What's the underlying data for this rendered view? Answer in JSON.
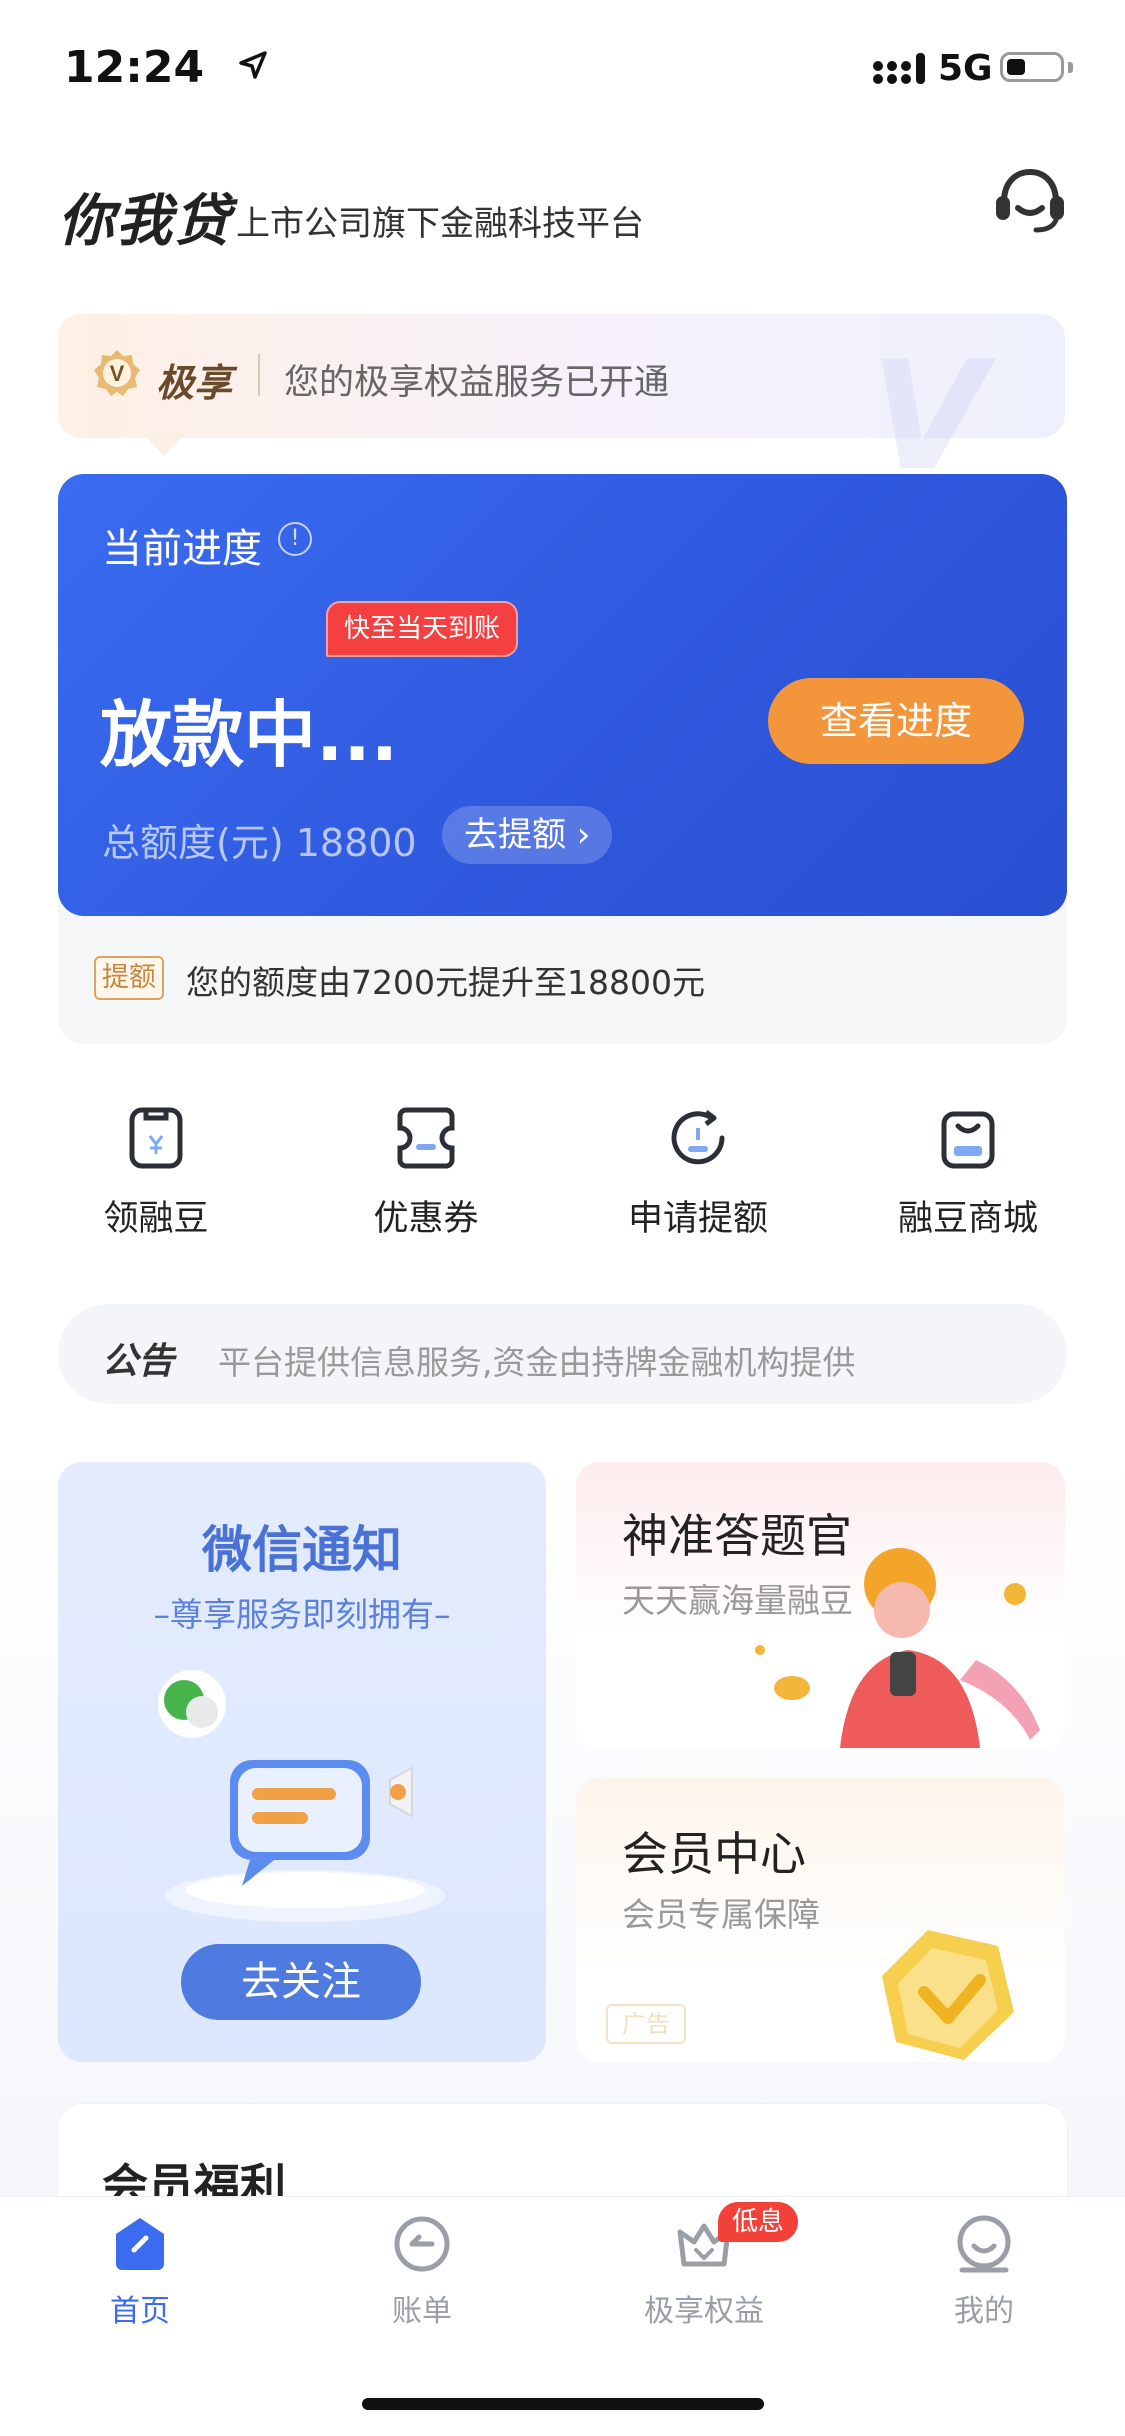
{
  "status_bar": {
    "time": "12:24",
    "network": "5G"
  },
  "header": {
    "brand": "你我贷",
    "subtitle": "上市公司旗下金融科技平台"
  },
  "vip_banner": {
    "title": "极享",
    "text": "您的极享权益服务已开通"
  },
  "progress": {
    "label": "当前进度",
    "fast_tag": "快至当天到账",
    "status": "放款中...",
    "check_button": "查看进度",
    "limit_text": "总额度(元) 18800",
    "raise_button": "去提额",
    "tip_tag": "提额",
    "tip_text": "您的额度由7200元提升至18800元"
  },
  "quick_actions": [
    {
      "label": "领融豆",
      "icon": "bean-icon"
    },
    {
      "label": "优惠券",
      "icon": "coupon-icon"
    },
    {
      "label": "申请提额",
      "icon": "raise-limit-icon"
    },
    {
      "label": "融豆商城",
      "icon": "shop-bag-icon"
    }
  ],
  "notice": {
    "title": "公告",
    "text": "平台提供信息服务,资金由持牌金融机构提供"
  },
  "wechat_card": {
    "title": "微信通知",
    "subtitle": "–尊享服务即刻拥有–",
    "button": "去关注"
  },
  "quiz_card": {
    "title": "神准答题官",
    "subtitle": "天天赢海量融豆"
  },
  "member_card": {
    "title": "会员中心",
    "subtitle": "会员专属保障",
    "ad_tag": "广告"
  },
  "welfare": {
    "title": "会员福利"
  },
  "tabbar": {
    "items": [
      {
        "label": "首页",
        "icon": "home-icon",
        "active": true
      },
      {
        "label": "账单",
        "icon": "bill-icon",
        "active": false
      },
      {
        "label": "极享权益",
        "icon": "crown-icon",
        "active": false
      },
      {
        "label": "我的",
        "icon": "profile-icon",
        "active": false
      }
    ],
    "badge": "低息"
  },
  "colors": {
    "primary": "#3b6cf0",
    "card_blue": "#2e57dc",
    "orange": "#f3953a",
    "red": "#f24138"
  }
}
